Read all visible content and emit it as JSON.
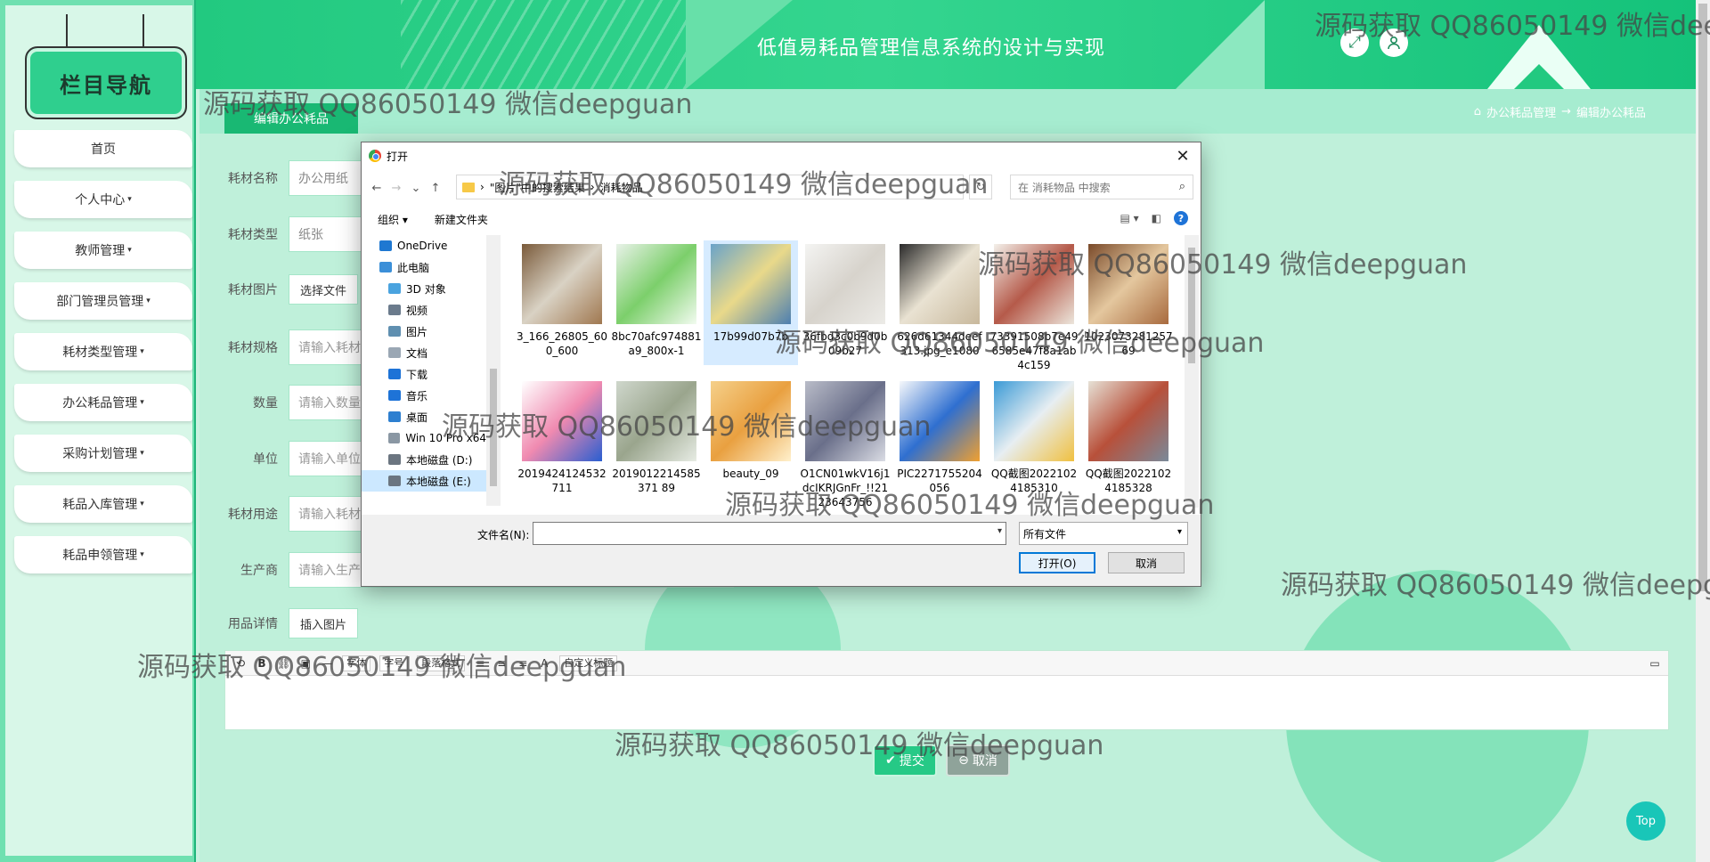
{
  "sidebar": {
    "title": "栏目导航",
    "items": [
      {
        "label": "首页",
        "caret": ""
      },
      {
        "label": "个人中心",
        "caret": "▾"
      },
      {
        "label": "教师管理",
        "caret": "▾"
      },
      {
        "label": "部门管理员管理",
        "caret": "▾"
      },
      {
        "label": "耗材类型管理",
        "caret": "▾"
      },
      {
        "label": "办公耗品管理",
        "caret": "▾"
      },
      {
        "label": "采购计划管理",
        "caret": "▾"
      },
      {
        "label": "耗品入库管理",
        "caret": "▾"
      },
      {
        "label": "耗品申领管理",
        "caret": "▾"
      }
    ]
  },
  "header": {
    "title": "低值易耗品管理信息系统的设计与实现",
    "fullscreen_icon": "expand-icon",
    "user_icon": "user-icon"
  },
  "breadcrumb": {
    "tab": "编辑办公耗品",
    "home_icon": "home-icon",
    "path1": "办公耗品管理",
    "separator": "→",
    "path2": "编辑办公耗品"
  },
  "form": {
    "name": {
      "label": "耗材名称",
      "value": "办公用纸"
    },
    "type": {
      "label": "耗材类型",
      "value": "纸张"
    },
    "image": {
      "label": "耗材图片",
      "button": "选择文件"
    },
    "spec": {
      "label": "耗材规格",
      "placeholder": "请输入耗材规格"
    },
    "qty": {
      "label": "数量",
      "placeholder": "请输入数量"
    },
    "unit": {
      "label": "单位",
      "placeholder": "请输入单位"
    },
    "usage": {
      "label": "耗材用途",
      "placeholder": "请输入耗材用途"
    },
    "maker": {
      "label": "生产商",
      "placeholder": "请输入生产商"
    },
    "detail": {
      "label": "用品详情",
      "button": "插入图片"
    },
    "toolbar": {
      "font": "字体",
      "size": "字号",
      "para": "段落格式",
      "font_color": "A",
      "custom_title": "自定义标题"
    }
  },
  "actions": {
    "submit": "提交",
    "cancel": "取消",
    "top": "Top"
  },
  "dialog": {
    "title": "打开",
    "close": "✕",
    "nav": {
      "back": "←",
      "forward": "→",
      "recent": "⌄",
      "up": "↑"
    },
    "address": {
      "part1": "\"图片\"中的搜索结果",
      "sep": "›",
      "part2": "消耗物品",
      "sep0": "›"
    },
    "refresh": "↻",
    "search_placeholder": "在 消耗物品 中搜索",
    "organize": "组织 ▾",
    "new_folder": "新建文件夹",
    "help": "?",
    "tree": [
      {
        "label": "OneDrive",
        "icon": "cloud-icon",
        "color": "#1f78d1",
        "indent": 20
      },
      {
        "label": "此电脑",
        "icon": "computer-icon",
        "color": "#3b8fd8",
        "indent": 20
      },
      {
        "label": "3D 对象",
        "icon": "3d-objects-icon",
        "color": "#4aa3df",
        "indent": 30
      },
      {
        "label": "视频",
        "icon": "video-icon",
        "color": "#6b7b8c",
        "indent": 30
      },
      {
        "label": "图片",
        "icon": "pictures-icon",
        "color": "#5f8fb0",
        "indent": 30
      },
      {
        "label": "文档",
        "icon": "documents-icon",
        "color": "#9aa7b4",
        "indent": 30
      },
      {
        "label": "下载",
        "icon": "download-icon",
        "color": "#1e73d7",
        "indent": 30
      },
      {
        "label": "音乐",
        "icon": "music-icon",
        "color": "#1e73d7",
        "indent": 30
      },
      {
        "label": "桌面",
        "icon": "desktop-icon",
        "color": "#2d7fd0",
        "indent": 30
      },
      {
        "label": "Win 10 Pro x64",
        "icon": "drive-icon",
        "color": "#8a97a3",
        "indent": 30
      },
      {
        "label": "本地磁盘 (D:)",
        "icon": "drive-icon",
        "color": "#6b7580",
        "indent": 30
      },
      {
        "label": "本地磁盘 (E:)",
        "icon": "drive-icon",
        "color": "#6b7580",
        "indent": 30
      }
    ],
    "files": [
      {
        "name": "3_166_26805_600_600",
        "colors": [
          "#7a5a3a",
          "#d9d2c4",
          "#a07850"
        ]
      },
      {
        "name": "8bc70afc974881a9_800x-1",
        "colors": [
          "#e8f2e8",
          "#7ccf6b",
          "#f2fbf0"
        ]
      },
      {
        "name": "17b99d07b7b",
        "colors": [
          "#6aa3c9",
          "#e9d98a",
          "#4d7fb0"
        ]
      },
      {
        "name": "36fbd3c0b9d0b09b27",
        "colors": [
          "#f4f4f2",
          "#d7d3cc",
          "#ecebe7"
        ]
      },
      {
        "name": "626d61344deef313.jpg_e1080",
        "colors": [
          "#2a2a2a",
          "#e9e2d2",
          "#c8b89c"
        ]
      },
      {
        "name": "73391508b7e496585e47f8a1ab4c159",
        "colors": [
          "#f3f0ea",
          "#b55a4a",
          "#ece6dc"
        ]
      },
      {
        "name": "102307328125769",
        "colors": [
          "#7a4a2a",
          "#e4c79e",
          "#a86a3e"
        ]
      },
      {
        "name": "2019424124532711",
        "colors": [
          "#ffffff",
          "#f08ab0",
          "#2a5ed0"
        ]
      },
      {
        "name": "2019012214585371 89",
        "colors": [
          "#cfd7cc",
          "#9aa58d",
          "#e7ece4"
        ]
      },
      {
        "name": "beauty_09",
        "colors": [
          "#f5d08a",
          "#e9a040",
          "#fff0cc"
        ]
      },
      {
        "name": "O1CN01wkV16j1dcIKRJGnFr_!!2123643756",
        "colors": [
          "#b9bcc8",
          "#6a6f8a",
          "#dadce4"
        ]
      },
      {
        "name": "PIC2271755204056",
        "colors": [
          "#f6f8fb",
          "#2f6fd0",
          "#f0a030"
        ]
      },
      {
        "name": "QQ截图20221024185310",
        "colors": [
          "#3a9ad6",
          "#e7eef2",
          "#f0c040"
        ]
      },
      {
        "name": "QQ截图20221024185328",
        "colors": [
          "#e6e1d6",
          "#b8503a",
          "#7a8a9a"
        ]
      }
    ],
    "filename_label": "文件名(N):",
    "filetype": "所有文件",
    "open_button": "打开(O)",
    "cancel_button": "取消"
  },
  "watermark": "源码获取 QQ86050149 微信deepguan"
}
